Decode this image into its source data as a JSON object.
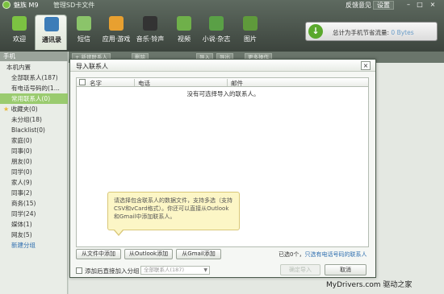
{
  "app": {
    "name": "魅族 M9",
    "sd_label": "管理SD卡文件",
    "feedback": "反馈意见",
    "settings": "设置"
  },
  "tabs": [
    {
      "label": "欢迎",
      "icon": "home-icon",
      "color": "#7cc242"
    },
    {
      "label": "通讯录",
      "icon": "contacts-icon",
      "color": "#3d7db8"
    },
    {
      "label": "短信",
      "icon": "sms-icon",
      "color": "#8bc46a"
    },
    {
      "label": "应用·游戏",
      "icon": "apps-icon",
      "color": "#e8a030"
    },
    {
      "label": "音乐·铃声",
      "icon": "headphones-icon",
      "color": "#333333"
    },
    {
      "label": "视频",
      "icon": "video-icon",
      "color": "#6fb04a"
    },
    {
      "label": "小说·杂志",
      "icon": "book-icon",
      "color": "#5aa046"
    },
    {
      "label": "图片",
      "icon": "picture-icon",
      "color": "#5f9a3b"
    }
  ],
  "traffic": {
    "text": "总计为手机节省流量:",
    "value": "0 Bytes"
  },
  "sidebar": {
    "header": "手机",
    "items": [
      {
        "label": "本机内置",
        "indent": 1
      },
      {
        "label": "全部联系人(187)",
        "indent": 2
      },
      {
        "label": "有电话号码的(1...",
        "indent": 2
      },
      {
        "label": "常用联系人(0)",
        "indent": 2,
        "selected": true
      },
      {
        "label": "收藏夹(0)",
        "indent": 1,
        "star": true
      },
      {
        "label": "未分组(18)",
        "indent": 2
      },
      {
        "label": "Blacklist(0)",
        "indent": 2
      },
      {
        "label": "家庭(0)",
        "indent": 2
      },
      {
        "label": "同事(0)",
        "indent": 2
      },
      {
        "label": "朋友(0)",
        "indent": 2
      },
      {
        "label": "同学(0)",
        "indent": 2
      },
      {
        "label": "家人(9)",
        "indent": 2
      },
      {
        "label": "同事(2)",
        "indent": 2
      },
      {
        "label": "商务(15)",
        "indent": 2
      },
      {
        "label": "同学(24)",
        "indent": 2
      },
      {
        "label": "媒体(1)",
        "indent": 2
      },
      {
        "label": "网友(5)",
        "indent": 2
      },
      {
        "label": "新建分组",
        "indent": 2,
        "link": true
      }
    ]
  },
  "toolbar": {
    "buttons": [
      "+ 新建联系人",
      "删除",
      "导入",
      "导出",
      "更多操作"
    ]
  },
  "dialog": {
    "title": "导入联系人",
    "close": "×",
    "columns": [
      "名字",
      "电话",
      "邮件"
    ],
    "empty_message": "没有可选择导入的联系人。",
    "tooltip": "请选择包含联系人的数据文件，支持多选（支持CSV和vCard格式）。你还可以直接从Outlook和Gmail中添加联系人。",
    "buttons": {
      "from_file": "从文件中添加",
      "from_outlook": "从Outlook添加",
      "from_gmail": "从Gmail添加",
      "confirm": "确定导入",
      "cancel": "取消"
    },
    "selected_prefix": "已选0个，",
    "selected_link": "只选有电话号码的联系人",
    "group_label": "添加后直接加入分组",
    "group_placeholder": "全部联系人(187)"
  },
  "watermark": "MyDrivers.com 驱动之家"
}
